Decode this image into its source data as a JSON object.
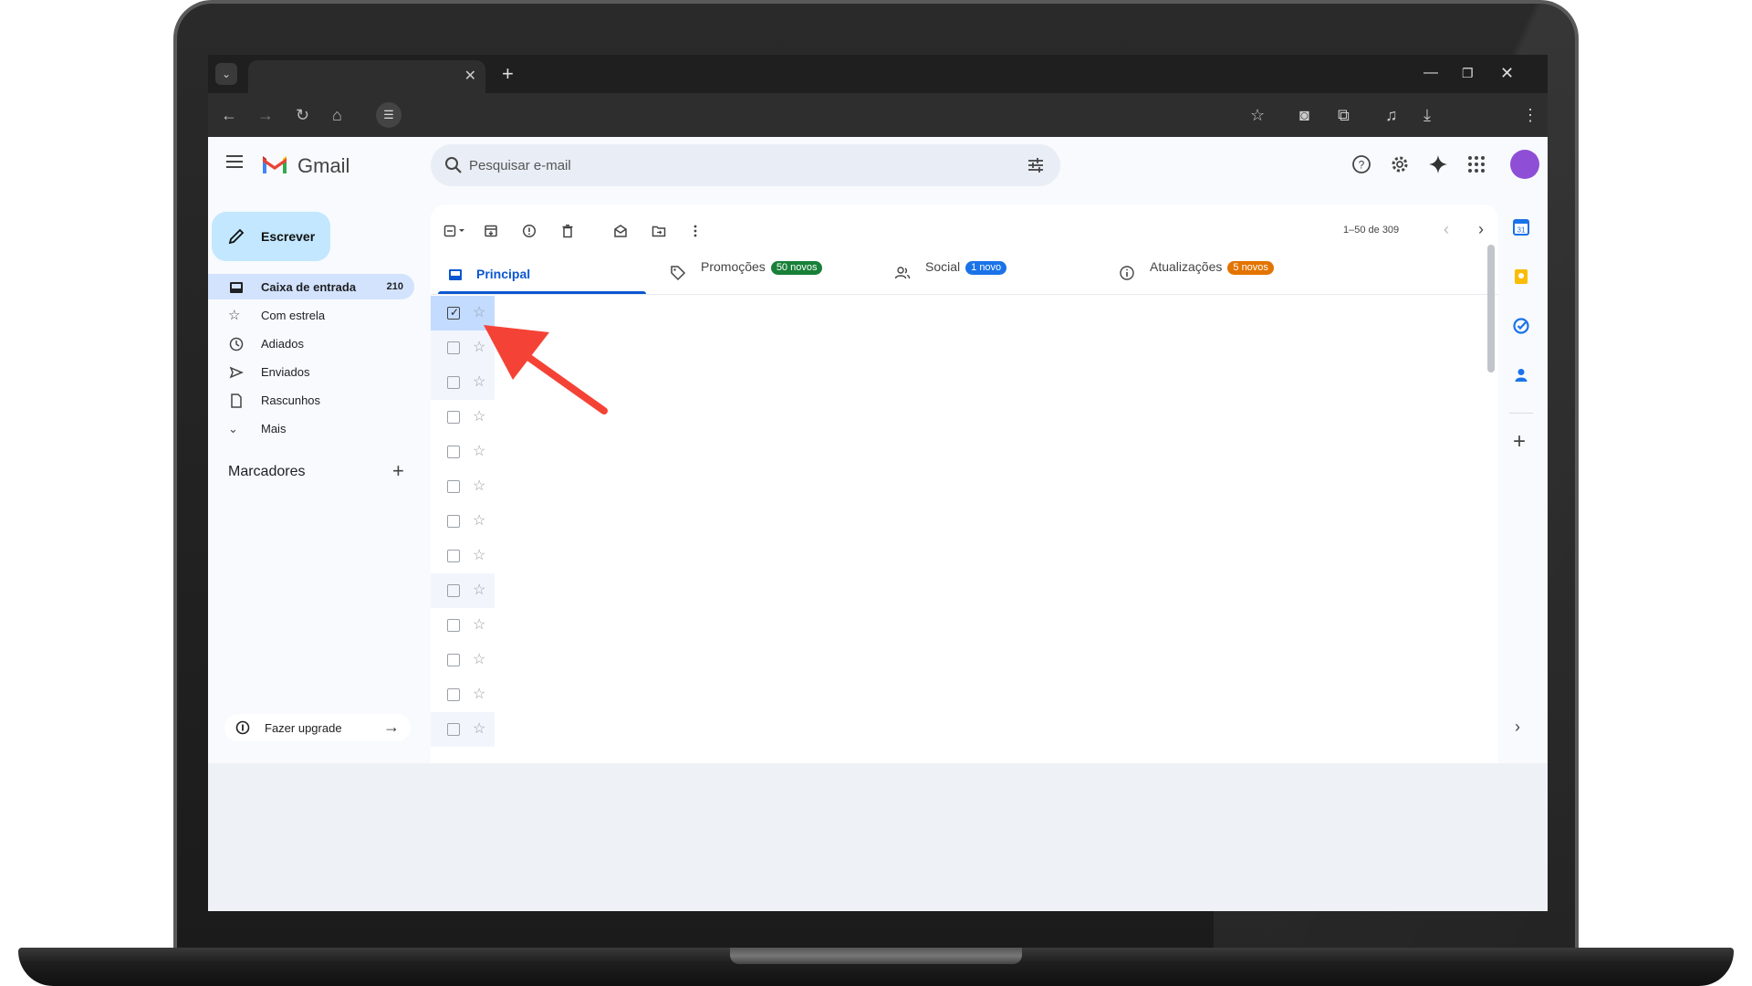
{
  "colors": {
    "accent": "#0b57d0",
    "compose_bg": "#c2e7ff",
    "selected_row": "#c2dbff",
    "arrow": "#f44336",
    "promo_badge": "#188038",
    "social_badge": "#1a73e8",
    "updates_badge": "#e37400"
  },
  "browser": {
    "tab_title": "",
    "icons": [
      "back-icon",
      "forward-icon",
      "reload-icon",
      "home-icon",
      "site-settings-icon",
      "bookmark-star-icon",
      "camera-icon",
      "extensions-icon",
      "media-icon",
      "download-icon",
      "browser-menu-icon"
    ]
  },
  "app": {
    "name": "Gmail"
  },
  "search": {
    "placeholder": "Pesquisar e-mail"
  },
  "compose": {
    "label": "Escrever"
  },
  "sidebar": {
    "items": [
      {
        "label": "Caixa de entrada",
        "count": "210",
        "icon": "inbox-icon"
      },
      {
        "label": "Com estrela",
        "count": "",
        "icon": "star-icon"
      },
      {
        "label": "Adiados",
        "count": "",
        "icon": "clock-icon"
      },
      {
        "label": "Enviados",
        "count": "",
        "icon": "send-icon"
      },
      {
        "label": "Rascunhos",
        "count": "",
        "icon": "draft-icon"
      },
      {
        "label": "Mais",
        "count": "",
        "icon": "chevron-down-icon"
      }
    ],
    "labels_title": "Marcadores",
    "upgrade_label": "Fazer upgrade"
  },
  "toolbar": {
    "pager": "1–50 de 309"
  },
  "tabs": [
    {
      "label": "Principal",
      "badge": ""
    },
    {
      "label": "Promoções",
      "badge": "50 novos"
    },
    {
      "label": "Social",
      "badge": "1 novo"
    },
    {
      "label": "Atualizações",
      "badge": "5 novos"
    }
  ],
  "rows": {
    "selected_index": 0,
    "count": 13
  }
}
